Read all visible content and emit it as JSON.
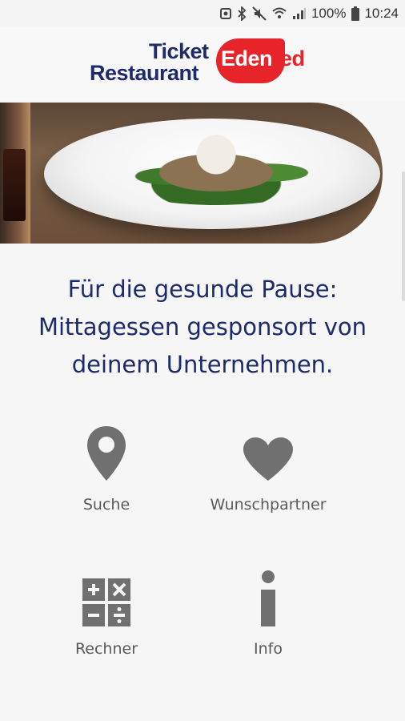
{
  "status_bar": {
    "battery_percent": "100%",
    "time": "10:24"
  },
  "logo": {
    "line1": "Ticket",
    "line2": "Restaurant",
    "brand_main": "Eden",
    "brand_tail": "red"
  },
  "tagline": {
    "line1": "Für die gesunde Pause:",
    "line2": "Mittagessen gesponsort von",
    "line3": "deinem Unternehmen."
  },
  "tiles": {
    "suche": {
      "label": "Suche",
      "icon": "map-pin-icon"
    },
    "wunschpartner": {
      "label": "Wunschpartner",
      "icon": "heart-icon"
    },
    "rechner": {
      "label": "Rechner",
      "icon": "calculator-icon"
    },
    "info": {
      "label": "Info",
      "icon": "info-icon"
    }
  },
  "colors": {
    "brand_navy": "#1d2a6b",
    "brand_red": "#e8242b",
    "icon_gray": "#707070"
  }
}
